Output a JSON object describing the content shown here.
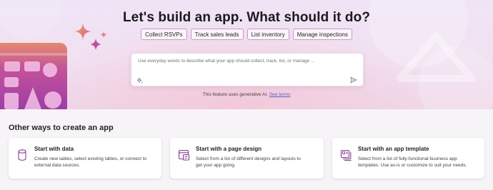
{
  "hero": {
    "title": "Let's build an app. What should it do?",
    "chips": [
      "Collect RSVPs",
      "Track sales leads",
      "List inventory",
      "Manage inspections"
    ],
    "prompt_placeholder": "Use everyday words to describe what your app should collect, track, list, or manage ...",
    "ai_note": "This feature uses generative AI.",
    "ai_note_link": "See terms"
  },
  "other_ways": {
    "title": "Other ways to create an app",
    "cards": [
      {
        "title": "Start with data",
        "description_line1": "Create new tables, select existing tables, or connect to",
        "description_line2": "external data sources.",
        "icon": "database-icon"
      },
      {
        "title": "Start with a page design",
        "description_line1": "Select from a list of different designs and layouts to",
        "description_line2": "get your app going.",
        "icon": "page-design-icon"
      },
      {
        "title": "Start with an app template",
        "description_line1": "Select from a list of fully-functional business app",
        "description_line2": "templates. Use as-is or customize to suit your needs.",
        "icon": "app-template-icon"
      }
    ]
  },
  "colors": {
    "accent": "#742774",
    "chip_border": "#c79ac6",
    "link": "#5b5fc7",
    "icon_purple": "#8a3a9a"
  }
}
